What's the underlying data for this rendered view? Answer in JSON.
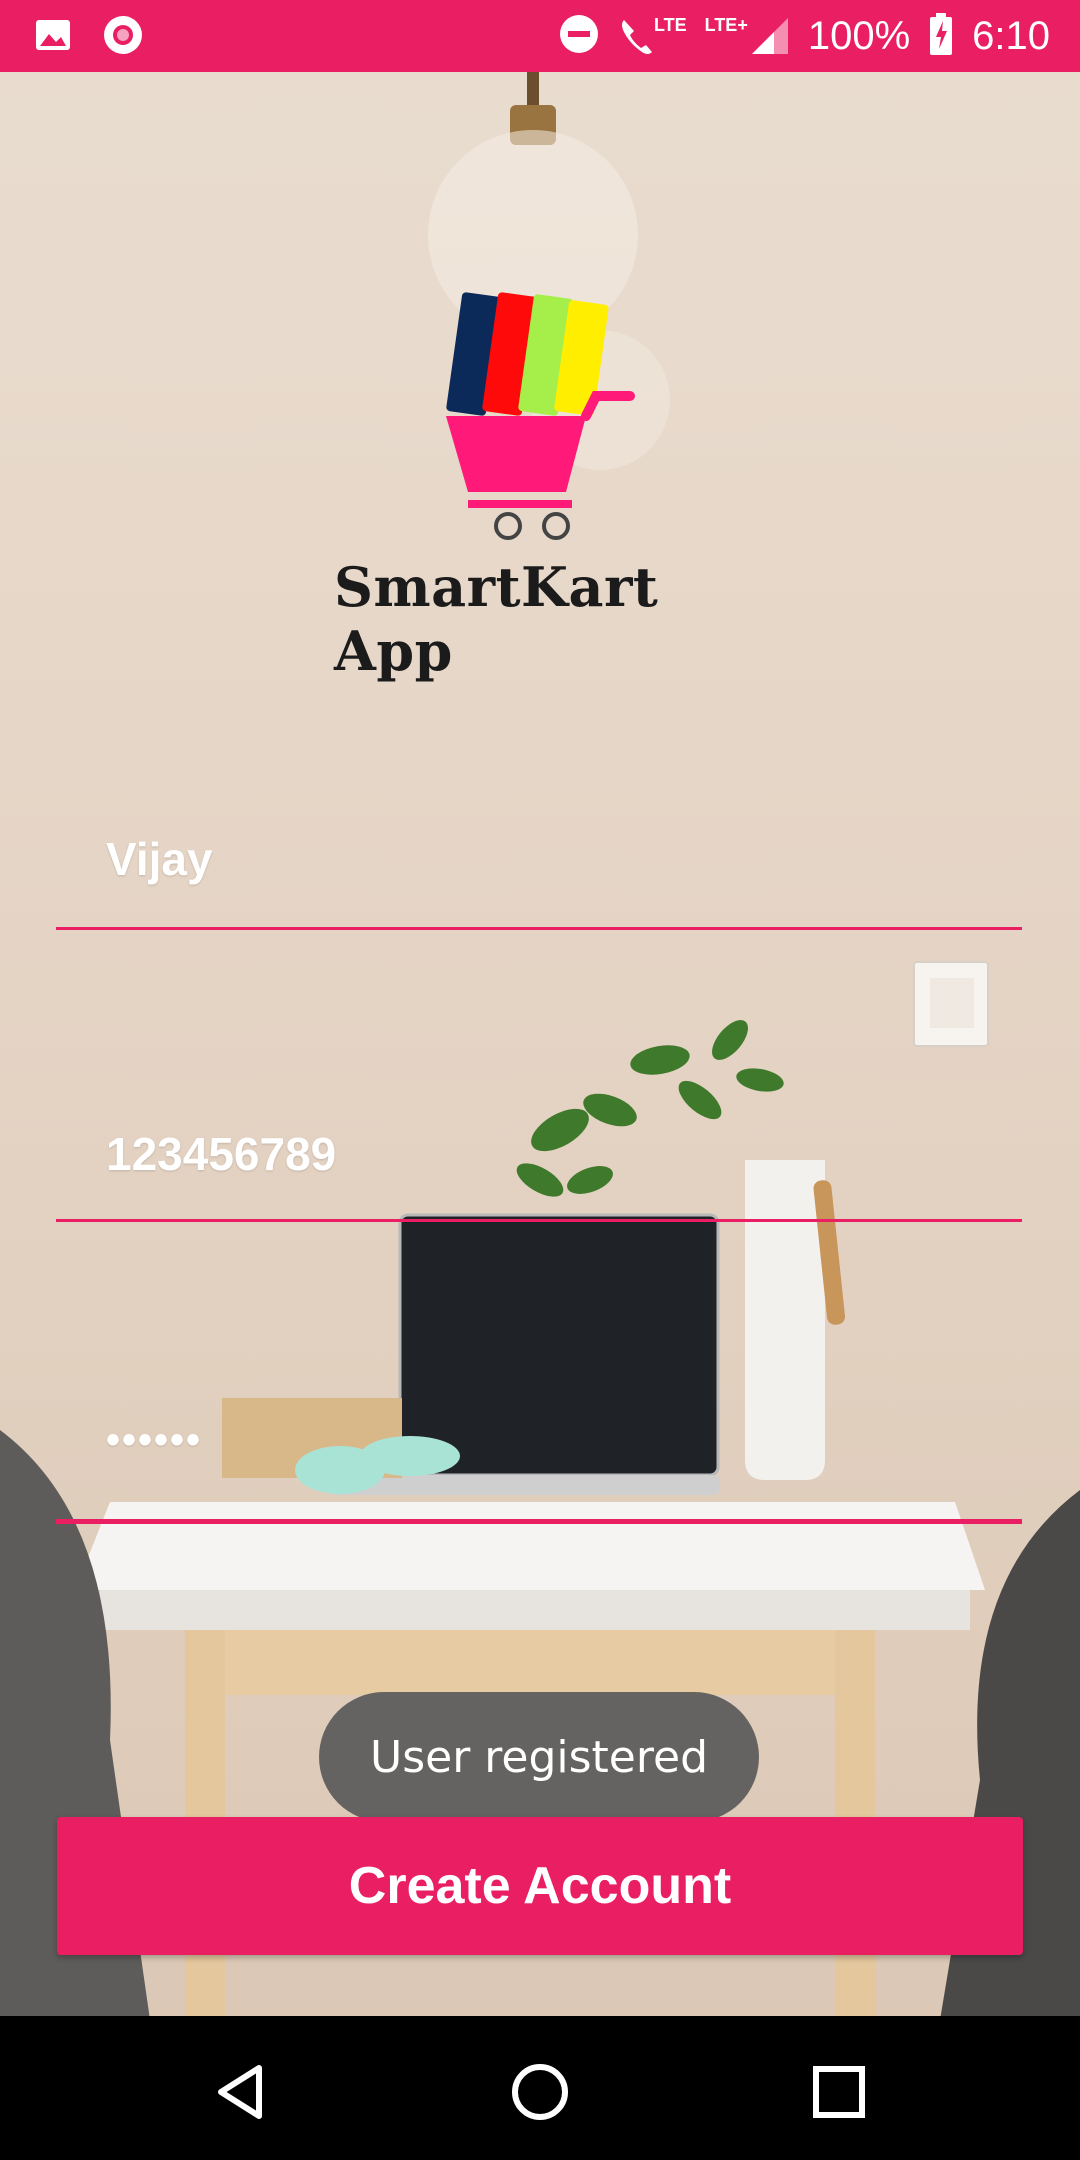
{
  "status_bar": {
    "battery_percent": "100%",
    "time": "6:10",
    "network_1": "LTE",
    "network_2": "LTE+",
    "icons": [
      "image-icon",
      "circle-record-icon",
      "do-not-disturb-icon",
      "wifi-call-icon",
      "signal-icon",
      "battery-charging-icon"
    ]
  },
  "app": {
    "title": "SmartKart App",
    "brand_color": "#e91e63"
  },
  "form": {
    "name_value": "Vijay",
    "phone_value": "123456789",
    "password_value": "••••••"
  },
  "toast": {
    "message": "User registered"
  },
  "primary_button": {
    "label": "Create Account"
  },
  "nav_bar": {
    "icons": [
      "back-icon",
      "home-icon",
      "recents-icon"
    ]
  }
}
